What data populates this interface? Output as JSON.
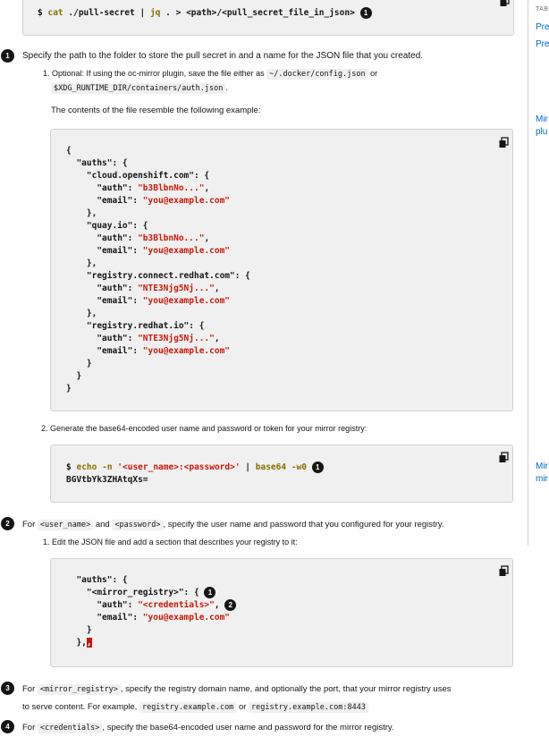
{
  "top_code": {
    "prompt": "$",
    "cmd": "cat",
    "arg": "./pull-secret",
    "pipe": "|",
    "jq": "jq",
    "dot": ".",
    "redir": ">",
    "path": "<path>/<pull_secret_file_in_json>",
    "callout": "1"
  },
  "callout1": {
    "num": "1",
    "text": "Specify the path to the folder to store the pull secret in and a name for the JSON file that you created."
  },
  "step1": {
    "label": "1. Optional: If using the oc-mirror plugin, save the file either as",
    "code1": "~/.docker/config.json",
    "or": "or",
    "code2": "$XDG_RUNTIME_DIR/containers/auth.json",
    "period": "."
  },
  "resemble": "The contents of the file resemble the following example:",
  "json_example": [
    "{",
    "  \"auths\": {",
    "    \"cloud.openshift.com\": {",
    "      \"auth\": \"b3BlbnNo...\",",
    "      \"email\": \"you@example.com\"",
    "    },",
    "    \"quay.io\": {",
    "      \"auth\": \"b3BlbnNo...\",",
    "      \"email\": \"you@example.com\"",
    "    },",
    "    \"registry.connect.redhat.com\": {",
    "      \"auth\": \"NTE3Njg5Nj...\",",
    "      \"email\": \"you@example.com\"",
    "    },",
    "    \"registry.redhat.io\": {",
    "      \"auth\": \"NTE3Njg5Nj...\",",
    "      \"email\": \"you@example.com\"",
    "    }",
    "  }",
    "}"
  ],
  "step2": {
    "label": "2. Generate the base64-encoded user name and password or token for your mirror registry:"
  },
  "b64_code": {
    "prompt": "$",
    "echo": "echo",
    "flag": "-n",
    "str": "'<user_name>:<password>'",
    "pipe": "|",
    "cmd": "base64",
    "flag2": "-w0",
    "callout": "1",
    "output": "BGVtbYk3ZHAtqXs="
  },
  "callout2": {
    "num": "2",
    "pre": "For",
    "code1": "<user_name>",
    "and": "and",
    "code2": "<password>",
    "post": ", specify the user name and password that you configured for your registry."
  },
  "step_edit": {
    "label": "1. Edit the JSON file and add a section that describes your registry to it:"
  },
  "auth_code": {
    "l1": "  \"auths\": {",
    "l2a": "    \"<mirror_registry>\": {",
    "l2c": "1",
    "l3a": "      \"auth\": ",
    "l3b": "\"<credentials>\"",
    "l3c": ",",
    "l3n": "2",
    "l4a": "      \"email\": ",
    "l4b": "\"you@example.com\"",
    "l5": "    }",
    "l6a": "  },",
    "l6b": ","
  },
  "callout3": {
    "num": "3",
    "pre": "For",
    "code1": "<mirror_registry>",
    "post": ", specify the registry domain name, and optionally the port, that your mirror registry uses",
    "line2": "to serve content. For example,",
    "code2": "registry.example.com",
    "or": "or",
    "code3": "registry.example.com:8443"
  },
  "callout4": {
    "num": "4",
    "pre": "For",
    "code1": "<credentials>",
    "post": ", specify the base64-encoded user name and password for the mirror registry."
  },
  "sidebar": {
    "heading": "TAB",
    "links": [
      "Pre",
      "Pre",
      "Mir",
      "plu",
      "Mir",
      "mir"
    ]
  }
}
